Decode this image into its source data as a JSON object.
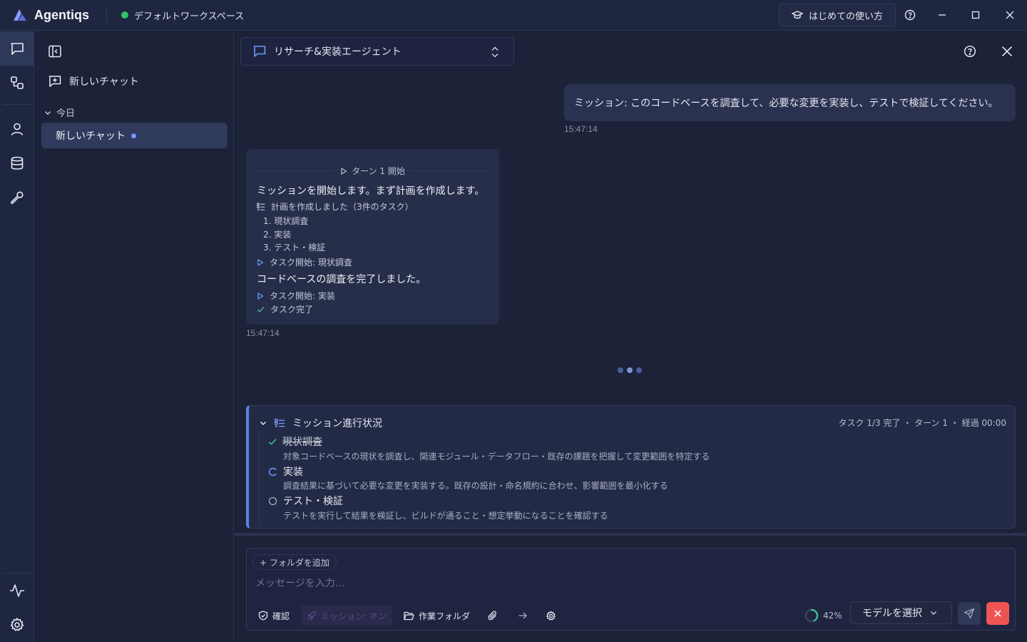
{
  "app": {
    "name": "Agentiqs",
    "workspace": "デフォルトワークスペース",
    "guide_label": "はじめての使い方"
  },
  "colors": {
    "accent": "#5a82e6",
    "status_online": "#2fc36a",
    "stop": "#ef5454",
    "unread_dot": "#6b9bff"
  },
  "sidebar": {
    "new_chat_label": "新しいチャット",
    "group_label": "今日",
    "items": [
      {
        "label": "新しいチャット",
        "unread": true
      }
    ]
  },
  "agent_selector": {
    "label": "リサーチ&実装エージェント"
  },
  "messages": {
    "user": {
      "text": "ミッション: このコードベースを調査して、必要な変更を実装し、テストで検証してください。",
      "time": "15:47:14"
    },
    "agent": {
      "turn_label": "ターン 1 開始",
      "intro": "ミッションを開始します。まず計画を作成します。",
      "plan_label": "計画を作成しました（3件のタスク）",
      "plan_items": [
        "1. 現状調査",
        "2. 実装",
        "3. テスト・検証"
      ],
      "task_start_1": "タスク開始: 現状調査",
      "completed_text": "コードベースの調査を完了しました。",
      "task_start_2": "タスク開始: 実装",
      "task_done": "タスク完了",
      "time": "15:47:14"
    }
  },
  "progress": {
    "title": "ミッション進行状況",
    "summary": "タスク 1/3 完了 ・ ターン 1 ・ 経過 00:00",
    "tasks": [
      {
        "title": "現状調査",
        "status": "done",
        "desc": "対象コードベースの現状を調査し、関連モジュール・データフロー・既存の課題を把握して変更範囲を特定する"
      },
      {
        "title": "実装",
        "status": "in-progress",
        "desc": "調査結果に基づいて必要な変更を実装する。既存の設計・命名規約に合わせ、影響範囲を最小化する"
      },
      {
        "title": "テスト・検証",
        "status": "pending",
        "desc": "テストを実行して結果を検証し、ビルドが通ること・想定挙動になることを確認する"
      }
    ]
  },
  "composer": {
    "add_folder_label": "+ フォルダを追加",
    "placeholder": "メッセージを入力...",
    "confirm_label": "確認",
    "mission_label": "ミッション: オン",
    "work_folder_label": "作業フォルダ",
    "context_percent": "42%",
    "context_fraction": 0.42,
    "model_placeholder": "モデルを選択"
  }
}
